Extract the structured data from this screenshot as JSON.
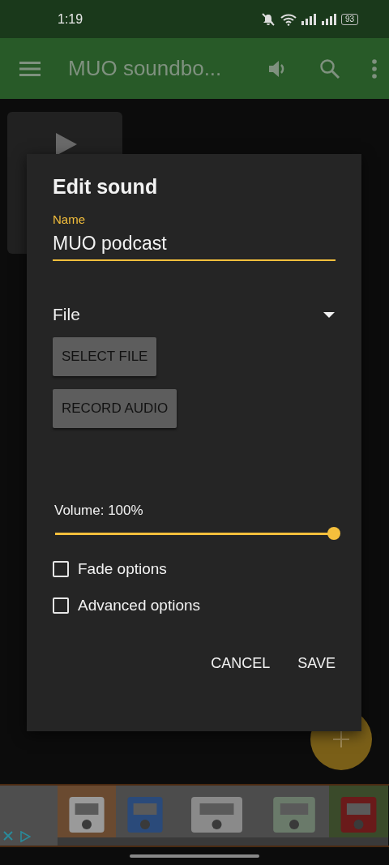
{
  "status_bar": {
    "time": "1:19",
    "battery": "93"
  },
  "toolbar": {
    "title": "MUO soundbo..."
  },
  "dialog": {
    "title": "Edit sound",
    "name_field": {
      "label": "Name",
      "value": "MUO podcast"
    },
    "file_dropdown": {
      "label": "File"
    },
    "file_buttons": [
      "SELECT FILE",
      "RECORD AUDIO"
    ],
    "volume": {
      "label": "Volume: 100%",
      "level": 1.0
    },
    "options": [
      {
        "label": "Fade options",
        "checked": false
      },
      {
        "label": "Advanced options",
        "checked": false
      }
    ],
    "actions": [
      "CANCEL",
      "SAVE"
    ]
  }
}
